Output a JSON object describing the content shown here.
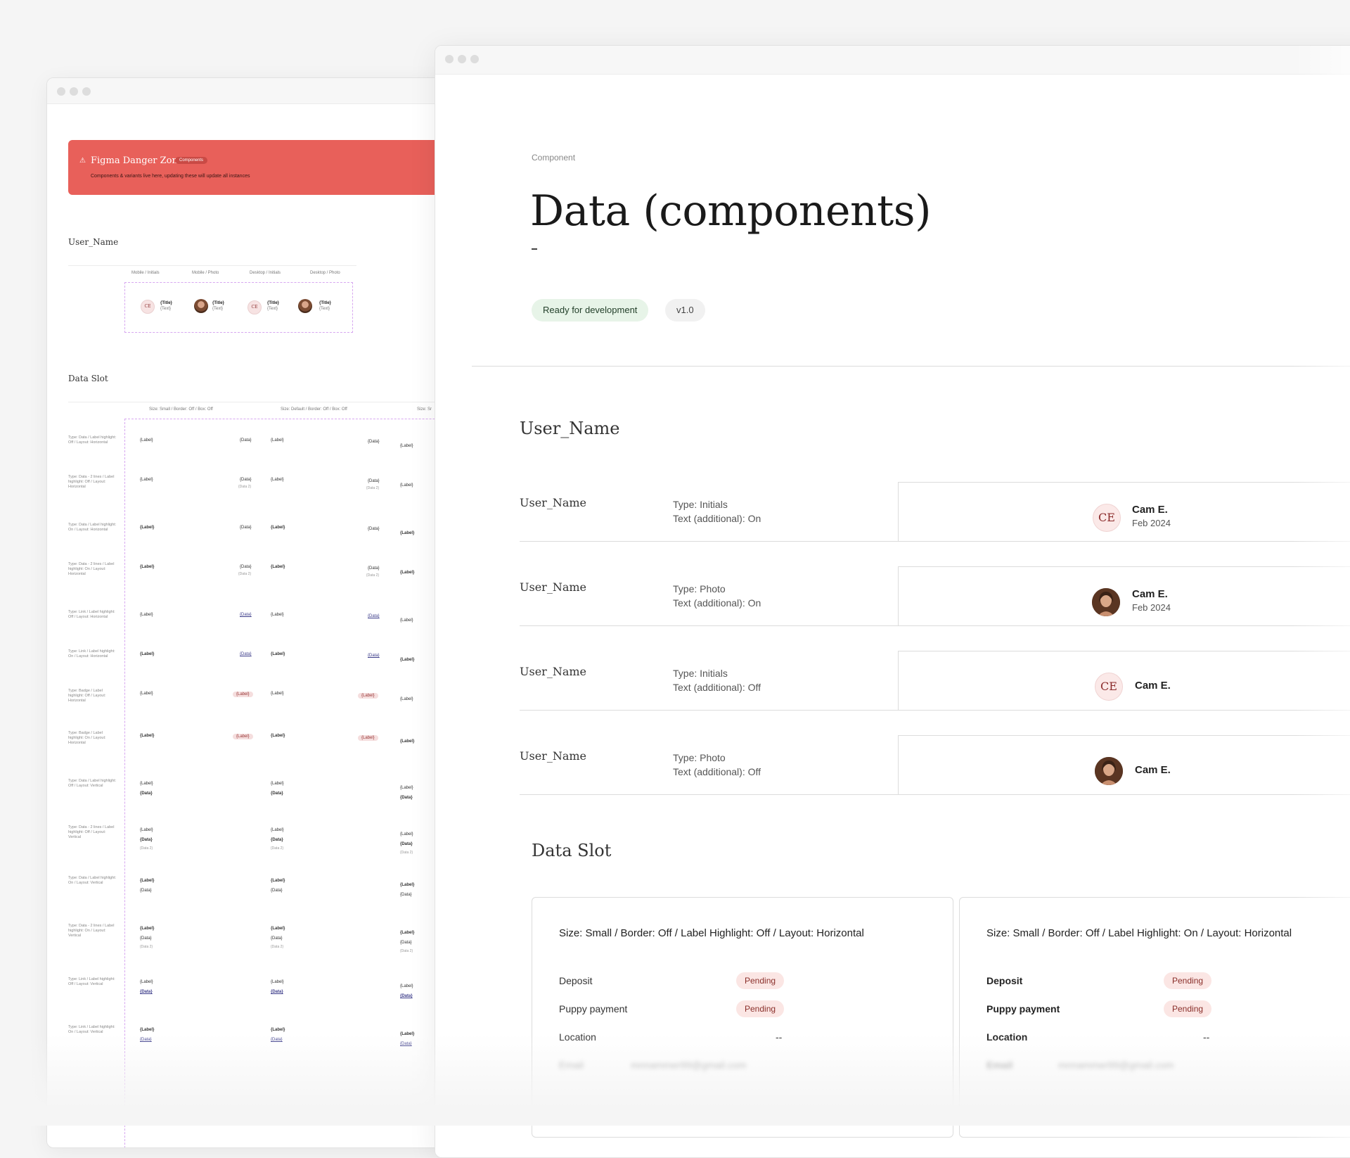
{
  "back": {
    "banner_title": "Figma Danger Zone",
    "banner_chip": "Components",
    "banner_sub": "Components & variants live here, updating these will update all instances",
    "sec_user": "User_Name",
    "user_cols": [
      "Mobile / Initials",
      "Mobile / Photo",
      "Desktop / Initials",
      "Desktop / Photo"
    ],
    "mini_title": "{Title}",
    "mini_text": "{Text}",
    "ce": "CE",
    "sec_slot": "Data Slot",
    "slot_cols": [
      "Size: Small / Border: Off / Box: Off",
      "Size: Default / Border: Off / Box: Off",
      "Size: Sr"
    ],
    "rows": [
      "Type: Data / Label highlight: Off / Layout: Horizontal",
      "Type: Data - 2 lines / Label highlight: Off / Layout: Horizontal",
      "Type: Data / Label highlight: On / Layout: Horizontal",
      "Type: Data - 2 lines / Label highlight: On / Layout: Horizontal",
      "Type: Link / Label highlight: Off / Layout: Horizontal",
      "Type: Link / Label highlight: On / Layout: Horizontal",
      "Type: Badge / Label highlight: Off / Layout: Horizontal",
      "Type: Badge / Label highlight: On / Layout: Horizontal",
      "Type: Data / Label highlight: Off / Layout: Vertical",
      "Type: Data - 2 lines / Label highlight: Off / Layout: Vertical",
      "Type: Data / Label highlight: On / Layout: Vertical",
      "Type: Data - 2 lines / Label highlight: On / Layout: Vertical",
      "Type: Link / Label highlight: Off / Layout: Vertical",
      "Type: Link / Label highlight: On / Layout: Vertical"
    ],
    "lbl": "{Label}",
    "dat": "{Data}",
    "dat2": "{Data 2}"
  },
  "front": {
    "breadcrumb": "Component",
    "title": "Data (components)",
    "dash": "-",
    "status": "Ready for development",
    "version": "v1.0",
    "sec_user": "User_Name",
    "user_rows": [
      {
        "name": "User_Name",
        "p1": "Type: Initials",
        "p2": "Text (additional): On",
        "initials": "CE",
        "uname": "Cam E.",
        "sub": "Feb 2024"
      },
      {
        "name": "User_Name",
        "p1": "Type: Photo",
        "p2": "Text (additional): On",
        "uname": "Cam E.",
        "sub": "Feb 2024"
      },
      {
        "name": "User_Name",
        "p1": "Type: Initials",
        "p2": "Text (additional): Off",
        "initials": "CE",
        "uname": "Cam E."
      },
      {
        "name": "User_Name",
        "p1": "Type: Photo",
        "p2": "Text (additional): Off",
        "uname": "Cam E."
      }
    ],
    "sec_slot": "Data Slot",
    "cards": [
      {
        "title": "Size: Small / Border: Off / Label Highlight: Off / Layout: Horizontal",
        "deposit": "Deposit",
        "puppy": "Puppy payment",
        "location": "Location",
        "email": "Email",
        "pending": "Pending",
        "dashes": "--",
        "email_val": "mnnammer99@gmail.com"
      },
      {
        "title": "Size: Small / Border: Off / Label Highlight: On / Layout: Horizontal",
        "deposit": "Deposit",
        "puppy": "Puppy payment",
        "location": "Location",
        "email": "Email",
        "pending": "Pending",
        "dashes": "--",
        "email_val": "mnnammer99@gmail.com"
      }
    ]
  }
}
